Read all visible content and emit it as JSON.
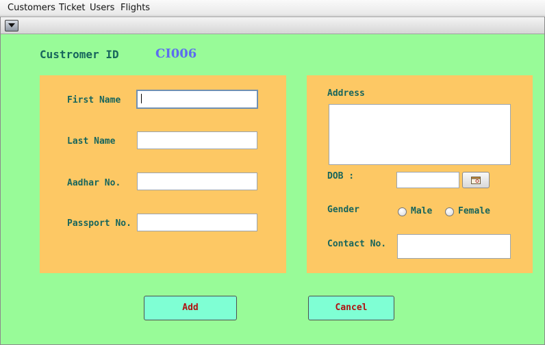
{
  "menubar": {
    "items": [
      "Customers",
      "Ticket",
      "Users",
      "Flights"
    ]
  },
  "form": {
    "customer_id_label": "Custromer ID",
    "customer_id_value": "CI006",
    "first_name_label": "First Name",
    "first_name_value": "",
    "last_name_label": "Last Name",
    "last_name_value": "",
    "aadhar_label": "Aadhar No.",
    "aadhar_value": "",
    "passport_label": "Passport No.",
    "passport_value": "",
    "address_label": "Address",
    "address_value": "",
    "dob_label": "DOB :",
    "dob_value": "",
    "gender_label": "Gender",
    "gender_options": [
      "Male",
      "Female"
    ],
    "contact_label": "Contact No.",
    "contact_value": ""
  },
  "buttons": {
    "add": "Add",
    "cancel": "Cancel"
  },
  "colors": {
    "background": "#98fb98",
    "panel": "#fdc864",
    "label_text": "#17655c",
    "id_text": "#5c6cf0",
    "button_bg": "#7fffd4",
    "button_text": "#b01010"
  }
}
